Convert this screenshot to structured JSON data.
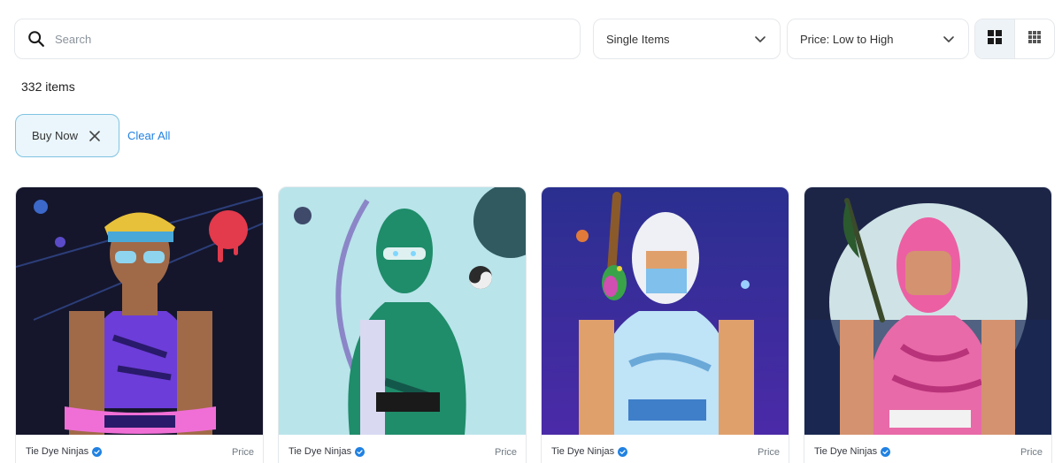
{
  "search": {
    "placeholder": "Search"
  },
  "filters": {
    "type_select": "Single Items",
    "sort_select": "Price: Low to High"
  },
  "results": {
    "count_label": "332 items"
  },
  "active_filters": [
    {
      "label": "Buy Now"
    }
  ],
  "clear_all_label": "Clear All",
  "view_modes": [
    {
      "icon": "large-grid-icon",
      "active": true
    },
    {
      "icon": "small-grid-icon",
      "active": false
    }
  ],
  "cards": [
    {
      "collection": "Tie Dye Ninjas",
      "price_label": "Price",
      "verified": true,
      "art": "ninja-blue-headband-purple"
    },
    {
      "collection": "Tie Dye Ninjas",
      "price_label": "Price",
      "verified": true,
      "art": "ninja-green-archer"
    },
    {
      "collection": "Tie Dye Ninjas",
      "price_label": "Price",
      "verified": true,
      "art": "ninja-white-parrot"
    },
    {
      "collection": "Tie Dye Ninjas",
      "price_label": "Price",
      "verified": true,
      "art": "ninja-pink-sword"
    }
  ],
  "colors": {
    "accent": "#2081e2",
    "chip_border": "#80c4e2",
    "chip_bg": "#eaf6fb",
    "verified": "#2081e2"
  }
}
